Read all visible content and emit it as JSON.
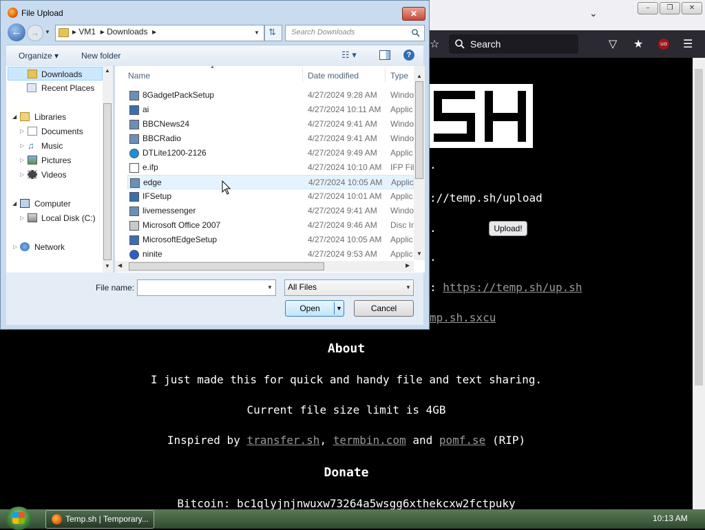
{
  "browser": {
    "search_placeholder": "Search",
    "addon_badge": "uo"
  },
  "page": {
    "upload_url": "://temp.sh/upload",
    "upload_button": "Upload!",
    "script_link": "https://temp.sh/up.sh",
    "sxcu_link": "mp.sh.sxcu",
    "about_heading": "About",
    "about_text": "I just made this for quick and handy file and text sharing.",
    "limit_text": "Current file size limit is 4GB",
    "inspired_prefix": "Inspired by",
    "inspired_link1": "transfer.sh",
    "inspired_comma": ",",
    "inspired_link2": "termbin.com",
    "inspired_and": "and",
    "inspired_link3": "pomf.se",
    "inspired_suffix": "(RIP)",
    "donate_heading": "Donate",
    "bitcoin": "Bitcoin: bc1qlyjnjnwuxw73264a5wsgg6xthekcxw2fctpuky"
  },
  "dialog": {
    "title": "File Upload",
    "breadcrumb": [
      "VM1",
      "Downloads"
    ],
    "search_placeholder": "Search Downloads",
    "organize": "Organize",
    "new_folder": "New folder",
    "nav": [
      {
        "label": "Downloads",
        "selected": true
      },
      {
        "label": "Recent Places"
      },
      {
        "label": "Libraries"
      },
      {
        "label": "Documents"
      },
      {
        "label": "Music"
      },
      {
        "label": "Pictures"
      },
      {
        "label": "Videos"
      },
      {
        "label": "Computer"
      },
      {
        "label": "Local Disk (C:)"
      },
      {
        "label": "Network"
      }
    ],
    "columns": {
      "name": "Name",
      "date": "Date modified",
      "type": "Type"
    },
    "files": [
      {
        "name": "8GadgetPackSetup",
        "date": "4/27/2024 9:28 AM",
        "type": "Windo"
      },
      {
        "name": "ai",
        "date": "4/27/2024 10:11 AM",
        "type": "Applic"
      },
      {
        "name": "BBCNews24",
        "date": "4/27/2024 9:41 AM",
        "type": "Windo"
      },
      {
        "name": "BBCRadio",
        "date": "4/27/2024 9:41 AM",
        "type": "Windo"
      },
      {
        "name": "DTLite1200-2126",
        "date": "4/27/2024 9:49 AM",
        "type": "Applic"
      },
      {
        "name": "e.ifp",
        "date": "4/27/2024 10:10 AM",
        "type": "IFP File"
      },
      {
        "name": "edge",
        "date": "4/27/2024 10:05 AM",
        "type": "Applic"
      },
      {
        "name": "IFSetup",
        "date": "4/27/2024 10:01 AM",
        "type": "Applic"
      },
      {
        "name": "livemessenger",
        "date": "4/27/2024 9:41 AM",
        "type": "Windo"
      },
      {
        "name": "Microsoft Office 2007",
        "date": "4/27/2024 9:46 AM",
        "type": "Disc In"
      },
      {
        "name": "MicrosoftEdgeSetup",
        "date": "4/27/2024 10:05 AM",
        "type": "Applic"
      },
      {
        "name": "ninite",
        "date": "4/27/2024 9:53 AM",
        "type": "Applic"
      }
    ],
    "filename_label": "File name:",
    "filename_value": "",
    "filter": "All Files",
    "open": "Open",
    "cancel": "Cancel"
  },
  "taskbar": {
    "task": "Temp.sh | Temporary...",
    "clock": "10:13 AM"
  },
  "colors": {
    "accent": "#3399ff",
    "link": "#9a9a9a"
  }
}
